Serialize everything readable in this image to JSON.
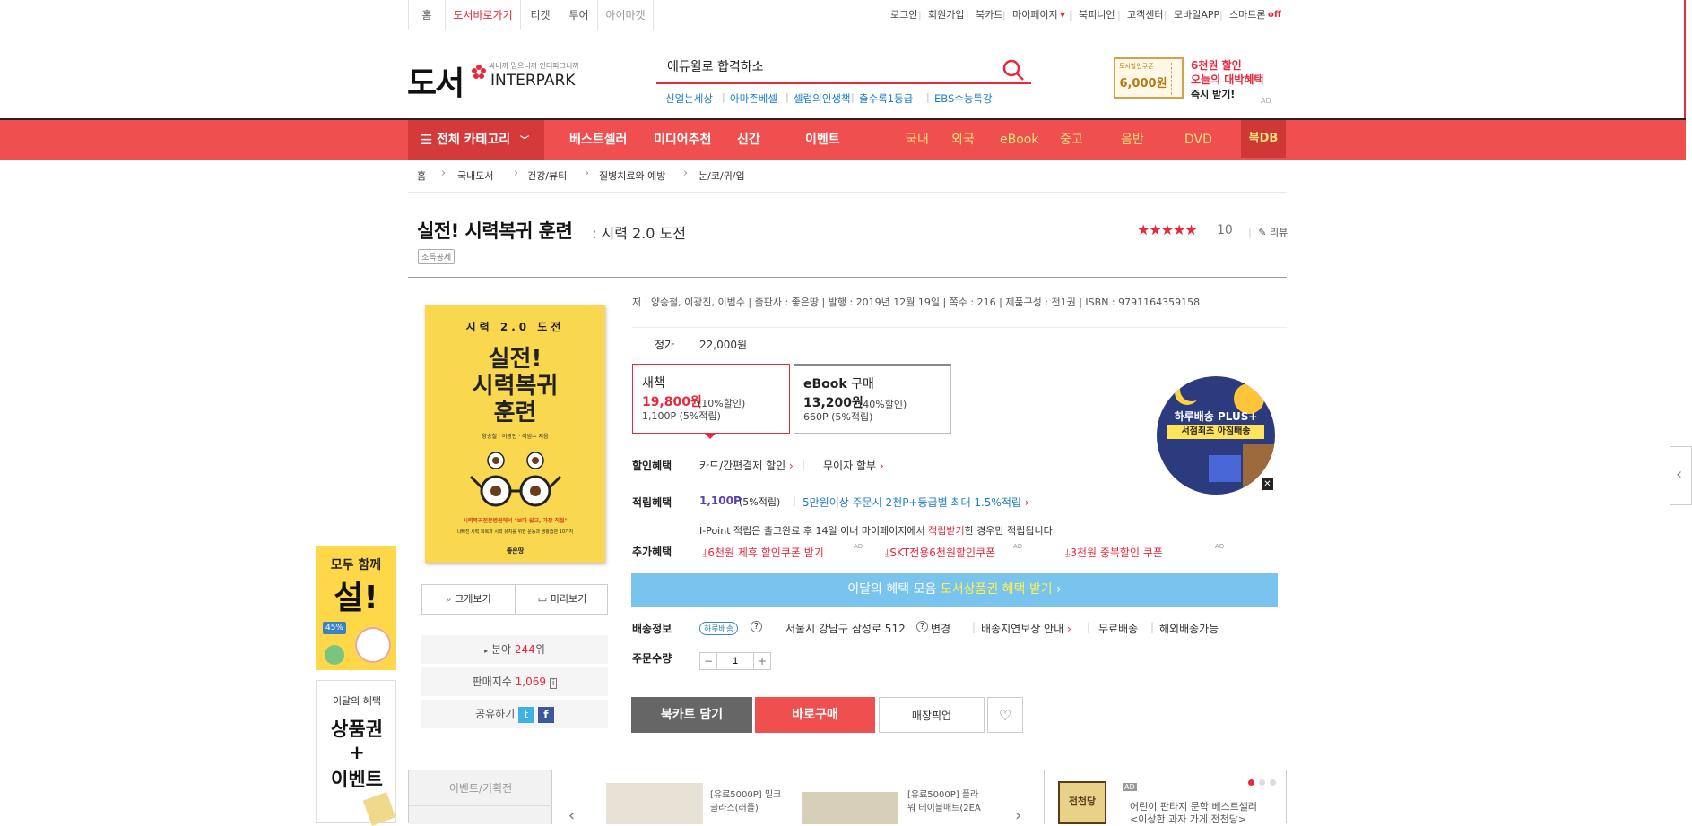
{
  "topbar": {
    "tabs": [
      "홈",
      "도서바로가기",
      "티켓",
      "투어",
      "아이마켓"
    ],
    "util": [
      "로그인",
      "회원가입",
      "북카트",
      "마이페이지",
      "북피니언",
      "고객센터",
      "모바일APP",
      "스마트론"
    ],
    "smartron_state": "off"
  },
  "header": {
    "logo_text": "도서",
    "logo_tagline": "싸니까 믿으니까 인터파크니까",
    "logo_brand": "INTERPARK",
    "search_value": "에듀윌로 합격하소",
    "keywords": [
      "신얼는세상",
      "아마존베셀",
      "셀럽의인생책",
      "출수록1등급",
      "EBS수능특강"
    ],
    "promo_small": "도서할인쿠폰",
    "promo_amount": "6,000원",
    "promo_line1": "6천원 할인",
    "promo_line2": "오늘의 대박혜택",
    "promo_line3": "즉시 받기!",
    "promo_ad": "AD"
  },
  "nav": {
    "category": "전체 카테고리",
    "main": [
      "베스트셀러",
      "미디어추천",
      "신간",
      "이벤트"
    ],
    "sub": [
      "국내",
      "외국",
      "eBook",
      "중고",
      "음반",
      "DVD"
    ],
    "bookdb": "북DB"
  },
  "breadcrumb": [
    "홈",
    "국내도서",
    "건강/뷰티",
    "질병치료와 예방",
    "눈/코/귀/입"
  ],
  "book": {
    "title": "실전! 시력복귀 훈련",
    "subtitle": ": 시력 2.0 도전",
    "badge": "소득공제",
    "stars": "★★★★★",
    "rating": "10",
    "review_label": "리뷰",
    "cover_top": "시력 2.0 도전",
    "cover_title1": "실전!",
    "cover_title2": "시력복귀",
    "cover_title3": "훈련",
    "cover_authors": "양승철 · 이광진 · 이범수 지음",
    "cover_tagline": "시력복귀전문병원에서 \"보다 쉽고, 가장 직접\"",
    "cover_desc": "나빠진 시력 회복과 시력 유지를 위한 운동과 생활습관 10가지",
    "cover_publisher": "좋은땅",
    "zoom_label": "크게보기",
    "preview_label": "미리보기",
    "rank_prefix": "분야",
    "rank_value": "244",
    "rank_suffix": "위",
    "sales_label": "판매지수",
    "sales_value": "1,069",
    "share_label": "공유하기"
  },
  "detail": {
    "meta": "저 : 양승철, 이광진, 이범수   |   출판사 : 좋은땅   |   발행 : 2019년 12월 19일   |   쪽수 : 216   |   제품구성 : 전1권   |   ISBN : 9791164359158",
    "list_price_label": "정가",
    "list_price": "22,000원",
    "new_title": "새책",
    "new_price": "19,800원",
    "new_discount": "(10%할인)",
    "new_points": "1,100P (5%적립)",
    "ebook_title": "eBook",
    "ebook_title_suffix": "구매",
    "ebook_price": "13,200원",
    "ebook_discount": "(40%할인)",
    "ebook_points": "660P (5%적립)",
    "discount_label": "할인혜택",
    "discount_card": "카드/간편결제 할인",
    "discount_installment": "무이자 할부",
    "points_label": "적립혜택",
    "points_value": "1,100P",
    "points_rate": "(5%적립)",
    "points_extra": "5만원이상 주문시 2천P+등급별 최대 1.5%적립",
    "ipoint_text": "I-Point 적립은 출고완료 후 14일 이내 마이페이지에서",
    "ipoint_link": "적립받기",
    "ipoint_suffix": "한 경우만 적립됩니다.",
    "extra_label": "추가혜택",
    "coupon1": "6천원 제휴 할인쿠폰 받기",
    "coupon2": "SKT전용6천원할인쿠폰",
    "coupon3": "3천원 중복할인 쿠폰",
    "ad_mark": "AD",
    "banner_text": "이달의 혜택 모음",
    "banner_highlight": "도서상품권 혜택 받기",
    "delivery_label": "배송정보",
    "delivery_badge": "하루배송",
    "delivery_address": "서울시 강남구 삼성로 512",
    "delivery_change": "변경",
    "delivery_guide": "배송지연보상 안내",
    "delivery_free": "무료배송",
    "delivery_overseas": "해외배송가능",
    "qty_label": "주문수량",
    "qty_value": "1",
    "cart_btn": "북카트 담기",
    "buy_btn": "바로구매",
    "pickup_btn": "매장픽업",
    "morning_title": "하루배송 PLUS+",
    "morning_sub": "서점최초 아침배송"
  },
  "ads": {
    "ad1_line1": "모두 함께",
    "ad1_line2": "설!",
    "ad1_badge": "45%",
    "ad2_line1": "이달의 혜택",
    "ad2_line2": "상품권",
    "ad2_line3": "+",
    "ad2_line4": "이벤트"
  },
  "bottom": {
    "tab1": "이벤트/기획전",
    "item1": "[유료5000P] 밀크글라스(러플)",
    "item2": "[유료5000P] 플라워 테이블매트(2EA",
    "promo_title": "전천당",
    "promo_text1": "어린이 판타지 문학 베스트셀러",
    "promo_text2": "<이상한 과자 가게 전천당>",
    "promo_ad": "AD"
  }
}
